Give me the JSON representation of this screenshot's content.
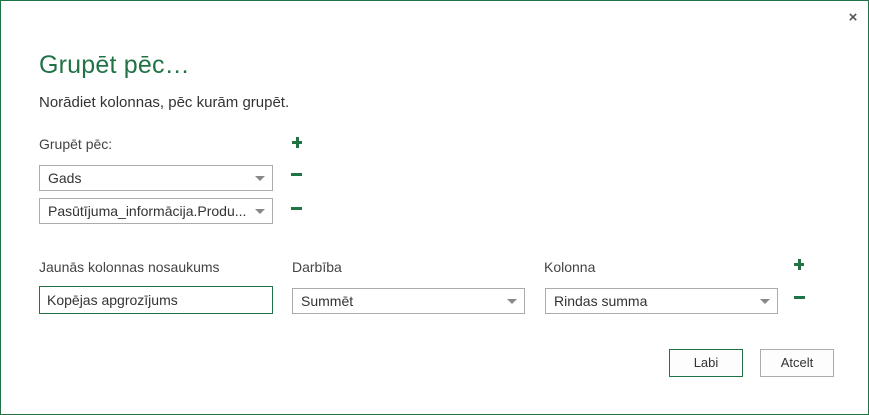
{
  "dialog": {
    "close_glyph": "×",
    "title": "Grupēt pēc…",
    "subtitle": "Norādiet kolonnas, pēc kurām grupēt."
  },
  "group_by": {
    "label": "Grupēt pēc:",
    "selects": [
      {
        "value": "Gads"
      },
      {
        "value": "Pasūtījuma_informācija.Produ..."
      }
    ]
  },
  "aggregation": {
    "headers": {
      "new_column": "Jaunās kolonnas nosaukums",
      "operation": "Darbība",
      "column": "Kolonna"
    },
    "rows": [
      {
        "new_column_name": "Kopējas apgrozījums",
        "operation": "Summēt",
        "column": "Rindas summa"
      }
    ]
  },
  "buttons": {
    "ok": "Labi",
    "cancel": "Atcelt"
  },
  "colors": {
    "accent": "#217346",
    "border": "#ababab"
  },
  "icons": {
    "add": "plus-icon",
    "remove": "minus-icon",
    "dropdown": "chevron-down-icon",
    "close": "close-icon"
  }
}
